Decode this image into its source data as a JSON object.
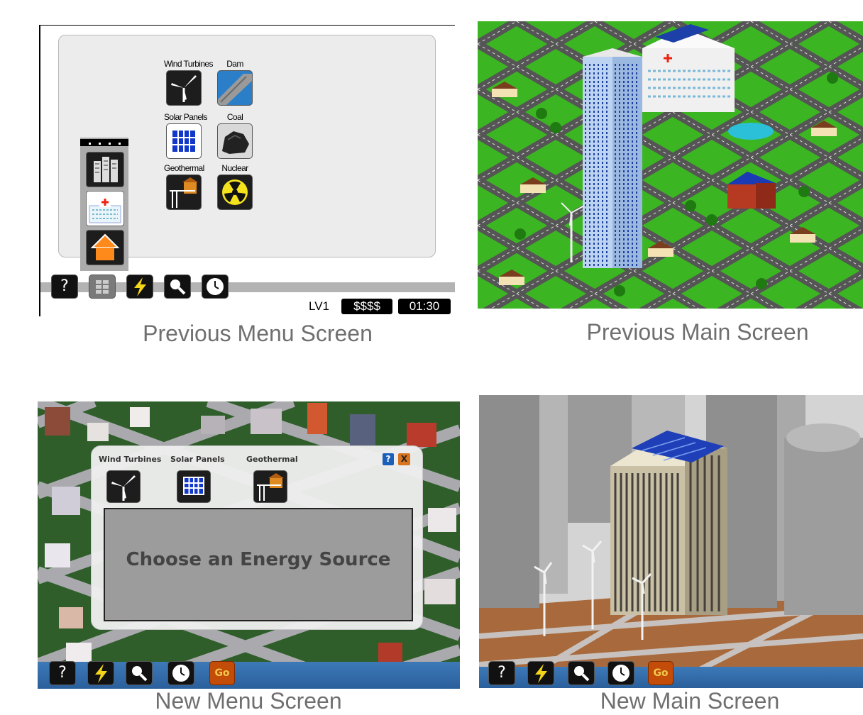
{
  "captions": {
    "prev_menu": "Previous Menu Screen",
    "prev_main": "Previous Main Screen",
    "new_menu": "New Menu Screen",
    "new_main": "New Main Screen"
  },
  "prev_menu": {
    "sources": [
      {
        "label": "Wind Turbines",
        "icon": "wind-turbine-icon"
      },
      {
        "label": "Dam",
        "icon": "dam-icon"
      },
      {
        "label": "Solar Panels",
        "icon": "solar-panel-icon"
      },
      {
        "label": "Coal",
        "icon": "coal-icon"
      },
      {
        "label": "Geothermal",
        "icon": "geothermal-icon"
      },
      {
        "label": "Nuclear",
        "icon": "nuclear-icon"
      }
    ],
    "sidebar": [
      "office-building-icon",
      "hospital-icon",
      "house-icon"
    ],
    "toolbar": {
      "help": "?",
      "icons": [
        "help-icon",
        "menu-icon",
        "lightning-icon",
        "magnifier-icon",
        "clock-icon"
      ]
    },
    "status": {
      "level": "LV1",
      "money": "$$$$",
      "time": "01:30"
    }
  },
  "new_menu": {
    "sources": [
      {
        "label": "Wind Turbines",
        "icon": "wind-turbine-icon"
      },
      {
        "label": "Solar Panels",
        "icon": "solar-panel-icon"
      },
      {
        "label": "Geothermal",
        "icon": "geothermal-icon"
      }
    ],
    "help": "?",
    "close": "X",
    "message": "Choose an Energy Source",
    "toolbar": {
      "help": "?",
      "go": "Go"
    }
  },
  "new_main": {
    "toolbar": {
      "help": "?",
      "go": "Go"
    }
  },
  "colors": {
    "caption": "#6f6f6f",
    "grass": "#2e9a1a",
    "go_button": "#c24c08",
    "help_badge": "#1b5fb8",
    "close_badge": "#d8741f"
  }
}
